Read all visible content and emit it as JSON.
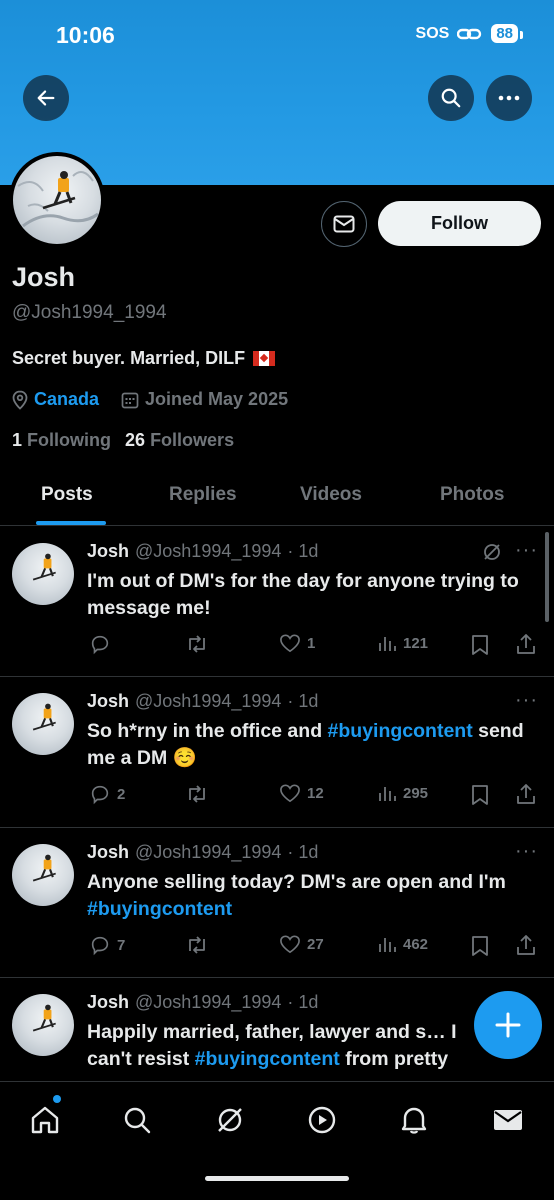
{
  "status_bar": {
    "time": "10:06",
    "sos": "SOS",
    "battery": "88"
  },
  "profile": {
    "name": "Josh",
    "handle": "@Josh1994_1994",
    "bio": "Secret buyer. Married, DILF",
    "location": "Canada",
    "joined": "Joined May 2025",
    "following_count": "1",
    "following_label": "Following",
    "followers_count": "26",
    "followers_label": "Followers",
    "follow_button": "Follow"
  },
  "tabs": [
    {
      "label": "Posts",
      "active": true
    },
    {
      "label": "Replies"
    },
    {
      "label": "Videos"
    },
    {
      "label": "Photos"
    }
  ],
  "posts": [
    {
      "name": "Josh",
      "handle": "@Josh1994_1994",
      "time": "· 1d",
      "text": "I'm out of DM's for the day for anyone trying to message me!",
      "replies": "",
      "likes": "1",
      "views": "121"
    },
    {
      "name": "Josh",
      "handle": "@Josh1994_1994",
      "time": "· 1d",
      "text_before": "So h*rny in the office and ",
      "hashtag": "#buyingcontent",
      "text_after": " send me a DM ☺️",
      "replies": "2",
      "likes": "12",
      "views": "295"
    },
    {
      "name": "Josh",
      "handle": "@Josh1994_1994",
      "time": "· 1d",
      "text_before": "Anyone selling today? DM's are open and I'm ",
      "hashtag": "#buyingcontent",
      "text_after": "",
      "replies": "7",
      "likes": "27",
      "views": "462"
    },
    {
      "name": "Josh",
      "handle": "@Josh1994_1994",
      "time": "· 1d",
      "text_before": "Happily married, father, lawyer and s… I can't resist ",
      "hashtag": "#buyingcontent",
      "text_after": " from pretty"
    }
  ],
  "colors": {
    "accent": "#1d9bf0",
    "banner": "#2399e3",
    "muted": "#71767b"
  }
}
